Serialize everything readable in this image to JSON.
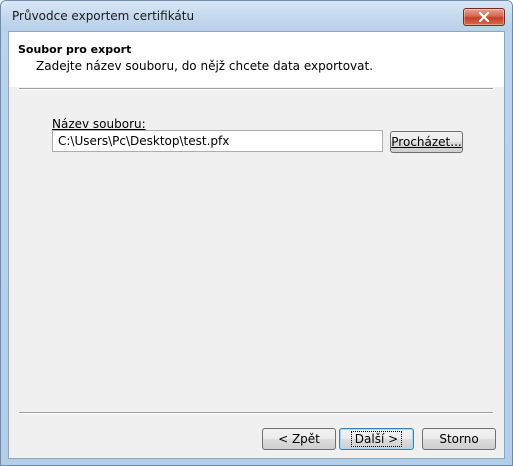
{
  "window": {
    "title": "Průvodce exportem certifikátu",
    "close_icon": "close-icon"
  },
  "header": {
    "title": "Soubor pro export",
    "subtitle": "Zadejte název souboru, do nějž chcete data exportovat."
  },
  "form": {
    "filename_label": "Název souboru:",
    "filename_value": "C:\\Users\\Pc\\Desktop\\test.pfx",
    "browse_label": "Procházet..."
  },
  "footer": {
    "back_label": "< Zpět",
    "next_label": "Další >",
    "cancel_label": "Storno"
  }
}
